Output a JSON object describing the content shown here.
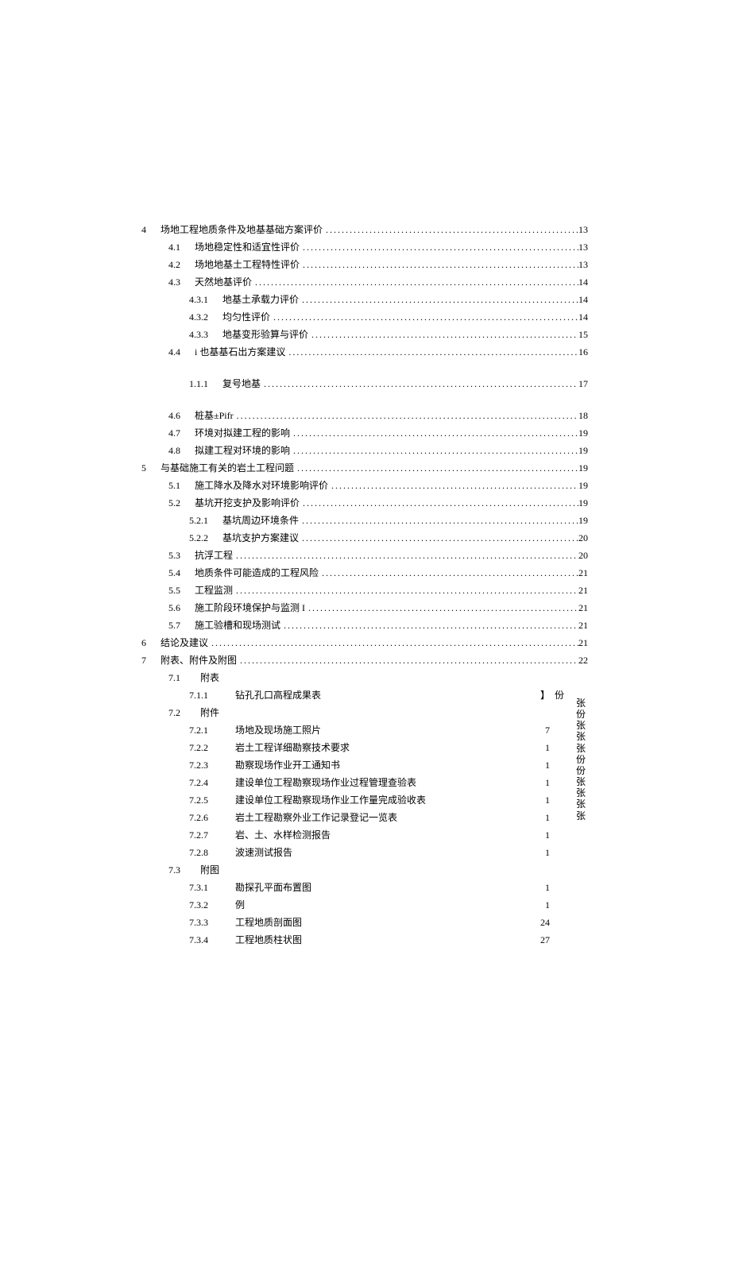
{
  "toc": [
    {
      "lvl": 0,
      "num": "4",
      "title": "场地工程地质条件及地基基础方案评价",
      "page": "13"
    },
    {
      "lvl": 1,
      "num": "4.1",
      "title": "场地稳定性和适宜性评价",
      "page": "13"
    },
    {
      "lvl": 1,
      "num": "4.2",
      "title": "场地地基土工程特性评价",
      "page": "13"
    },
    {
      "lvl": 1,
      "num": "4.3",
      "title": "天然地基评价",
      "page": "14"
    },
    {
      "lvl": 2,
      "num": "4.3.1",
      "title": "地基土承载力评价",
      "page": "14"
    },
    {
      "lvl": 2,
      "num": "4.3.2",
      "title": "均匀性评价",
      "page": "14"
    },
    {
      "lvl": 2,
      "num": "4.3.3",
      "title": "地基变形验算与评价",
      "page": "15"
    },
    {
      "lvl": 1,
      "num": "4.4",
      "title": "i 也基基石出方案建议",
      "page": "16"
    },
    {
      "lvl": 2,
      "num": "1.1.1",
      "title": "复号地基",
      "page": "17"
    },
    {
      "lvl": 1,
      "num": "4.6",
      "title": "桩基±Pifr",
      "page": "18"
    },
    {
      "lvl": 1,
      "num": "4.7",
      "title": "环境对拟建工程的影响",
      "page": "19"
    },
    {
      "lvl": 1,
      "num": "4.8",
      "title": "拟建工程对环境的影响",
      "page": "19"
    },
    {
      "lvl": 0,
      "num": "5",
      "title": "与基础施工有关的岩土工程问题",
      "page": "19"
    },
    {
      "lvl": 1,
      "num": "5.1",
      "title": "施工降水及降水对环境影响评价",
      "page": "19"
    },
    {
      "lvl": 1,
      "num": "5.2",
      "title": "基坑开挖支护及影响评价",
      "page": "19"
    },
    {
      "lvl": 2,
      "num": "5.2.1",
      "title": "基坑周边环境条件",
      "page": "19"
    },
    {
      "lvl": 2,
      "num": "5.2.2",
      "title": "基坑支护方案建议",
      "page": "20"
    },
    {
      "lvl": 1,
      "num": "5.3",
      "title": "抗浮工程",
      "page": "20"
    },
    {
      "lvl": 1,
      "num": "5.4",
      "title": "地质条件可能造成的工程风险",
      "page": "21"
    },
    {
      "lvl": 1,
      "num": "5.5",
      "title": "工程监测",
      "page": "21"
    },
    {
      "lvl": 1,
      "num": "5.6",
      "title": "施工阶段环境保护与监测 I",
      "page": "21"
    },
    {
      "lvl": 1,
      "num": "5.7",
      "title": "施工验槽和现场测试",
      "page": "21"
    },
    {
      "lvl": 0,
      "num": "6",
      "title": "结论及建议",
      "page": "21"
    },
    {
      "lvl": 0,
      "num": "7",
      "title": "附表、附件及附图",
      "page": "22"
    }
  ],
  "sec71": {
    "num": "7.1",
    "title": "附表"
  },
  "sec71_item": {
    "num": "7.1.1",
    "title": "钻孔孔口高程成果表",
    "count": "】",
    "unit": "份"
  },
  "sec72": {
    "num": "7.2",
    "title": "附件"
  },
  "sec72_items": [
    {
      "num": "7.2.1",
      "title": "场地及现场施工照片",
      "count": "7"
    },
    {
      "num": "7.2.2",
      "title": "岩土工程详细勘察技术要求",
      "count": "1"
    },
    {
      "num": "7.2.3",
      "title": "勘察现场作业开工通知书",
      "count": "1"
    },
    {
      "num": "7.2.4",
      "title": "建设单位工程勘察现场作业过程管理查验表",
      "count": "1"
    },
    {
      "num": "7.2.5",
      "title": "建设单位工程勘察现场作业工作量完成验收表",
      "count": "1"
    },
    {
      "num": "7.2.6",
      "title": "岩土工程勘察外业工作记录登记一览表",
      "count": "1"
    },
    {
      "num": "7.2.7",
      "title": "岩、土、水样检测报告",
      "count": "1"
    },
    {
      "num": "7.2.8",
      "title": "波速测试报告",
      "count": "1"
    }
  ],
  "sec73": {
    "num": "7.3",
    "title": "附图"
  },
  "sec73_items": [
    {
      "num": "7.3.1",
      "title": "勘探孔平面布置图",
      "count": "1"
    },
    {
      "num": "7.3.2",
      "title": "例",
      "count": "1"
    },
    {
      "num": "7.3.3",
      "title": "工程地质剖面图",
      "count": "24"
    },
    {
      "num": "7.3.4",
      "title": "工程地质柱状图",
      "count": "27"
    }
  ],
  "vert_units": [
    "张",
    "份",
    "张",
    "张",
    "张",
    "份",
    "份",
    "张",
    "张",
    "张",
    "张"
  ]
}
